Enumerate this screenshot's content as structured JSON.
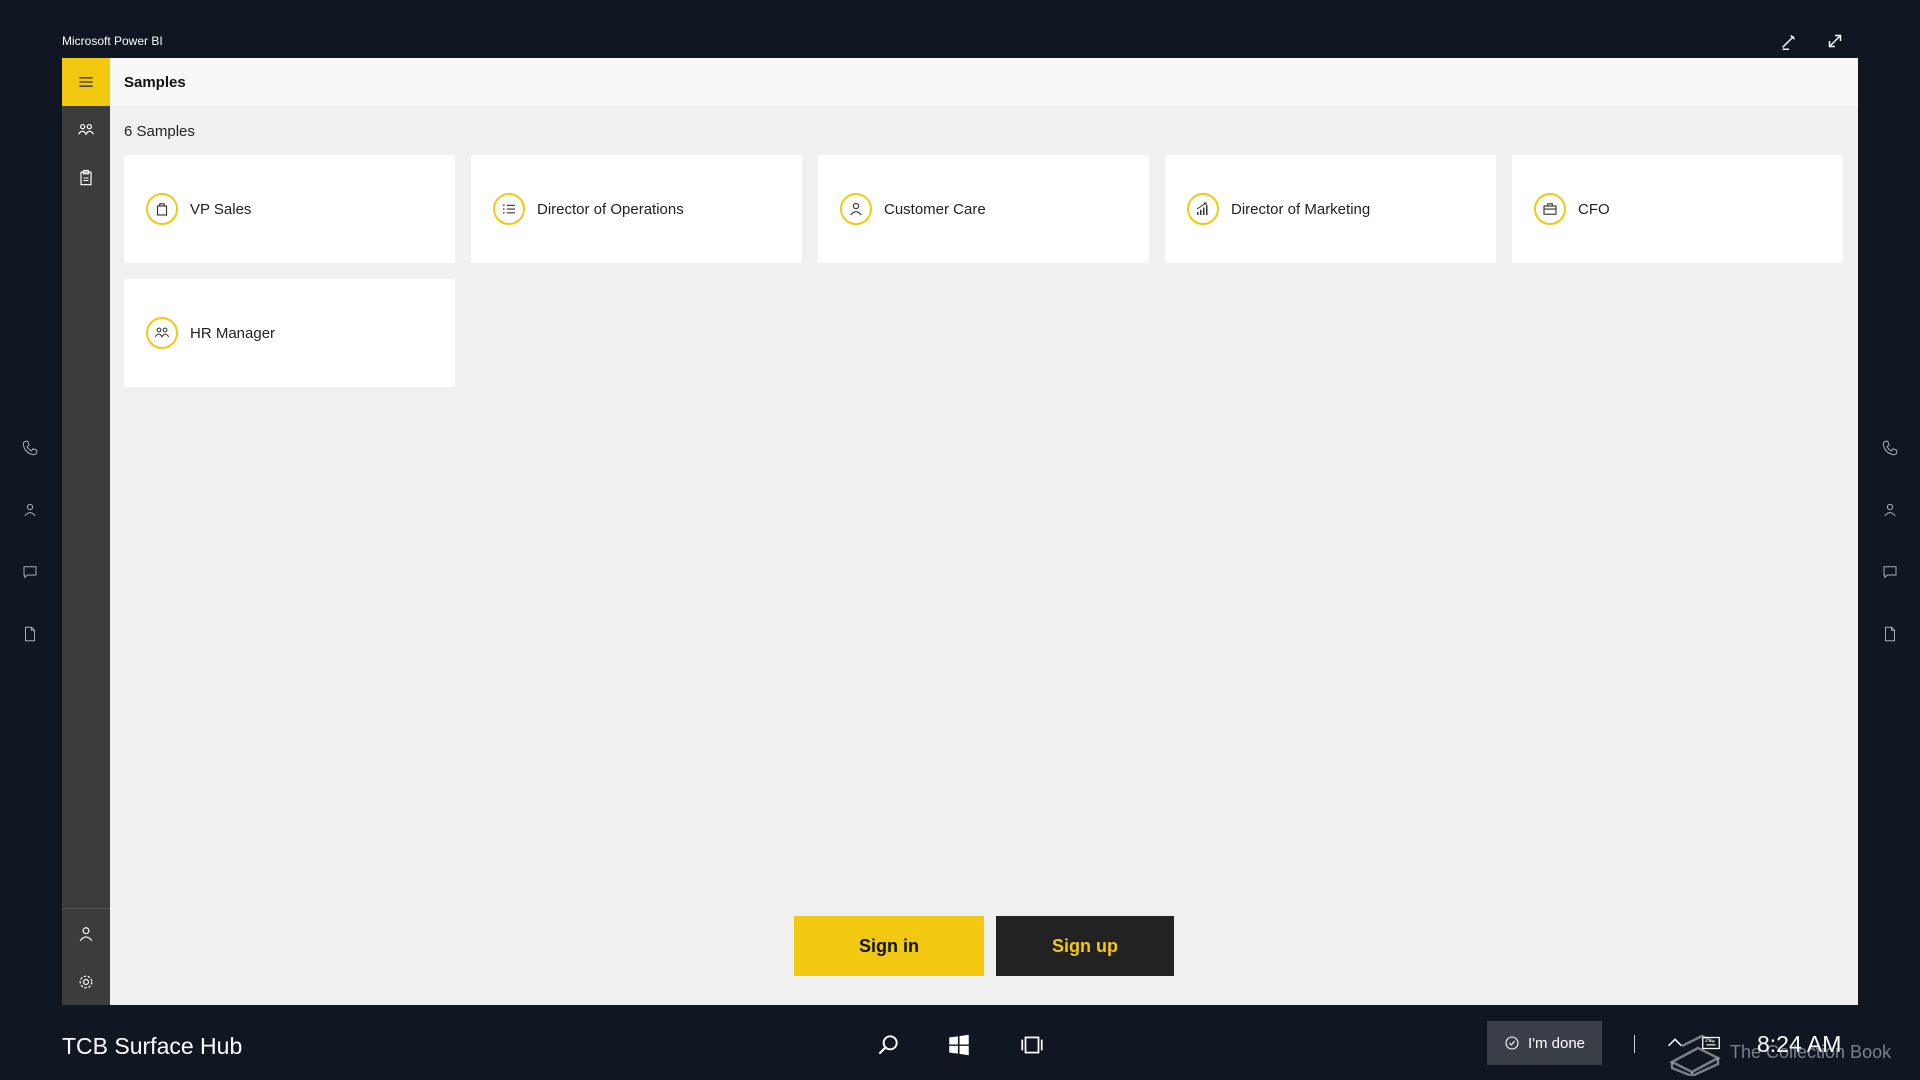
{
  "window": {
    "title": "Microsoft Power BI",
    "controls": [
      {
        "icon": "pen-icon"
      },
      {
        "icon": "expand-icon"
      }
    ]
  },
  "header": {
    "title": "Samples"
  },
  "nav": {
    "items": [
      {
        "icon": "hamburger-menu-icon"
      },
      {
        "icon": "group-icon"
      },
      {
        "icon": "clipboard-icon"
      },
      {
        "icon": "user-icon"
      },
      {
        "icon": "gear-icon"
      }
    ]
  },
  "samples": {
    "count_label": "6 Samples",
    "items": [
      {
        "label": "VP Sales",
        "icon": "shopping-bag-icon"
      },
      {
        "label": "Director of Operations",
        "icon": "checklist-icon"
      },
      {
        "label": "Customer Care",
        "icon": "user-icon"
      },
      {
        "label": "Director of Marketing",
        "icon": "growth-chart-icon"
      },
      {
        "label": "CFO",
        "icon": "briefcase-icon"
      },
      {
        "label": "HR Manager",
        "icon": "people-icon"
      }
    ]
  },
  "actions": {
    "signin_label": "Sign in",
    "signup_label": "Sign up"
  },
  "side_rails": {
    "icons": [
      "phone-icon",
      "user-icon",
      "chat-icon",
      "document-icon"
    ]
  },
  "taskbar": {
    "device_name": "TCB Surface Hub",
    "buttons": [
      "search-icon",
      "windows-icon",
      "task-view-icon"
    ],
    "done_label": "I'm done",
    "tray": [
      "chevron-up-icon",
      "keyboard-icon"
    ],
    "clock": "8:24 AM"
  },
  "watermark": {
    "text": "The Collection Book"
  },
  "colors": {
    "accent": "#f2c811",
    "background": "#101722",
    "nav": "#3c3c3c",
    "content": "#f0f0f0",
    "tile": "#ffffff",
    "signup_bg": "#222222"
  }
}
